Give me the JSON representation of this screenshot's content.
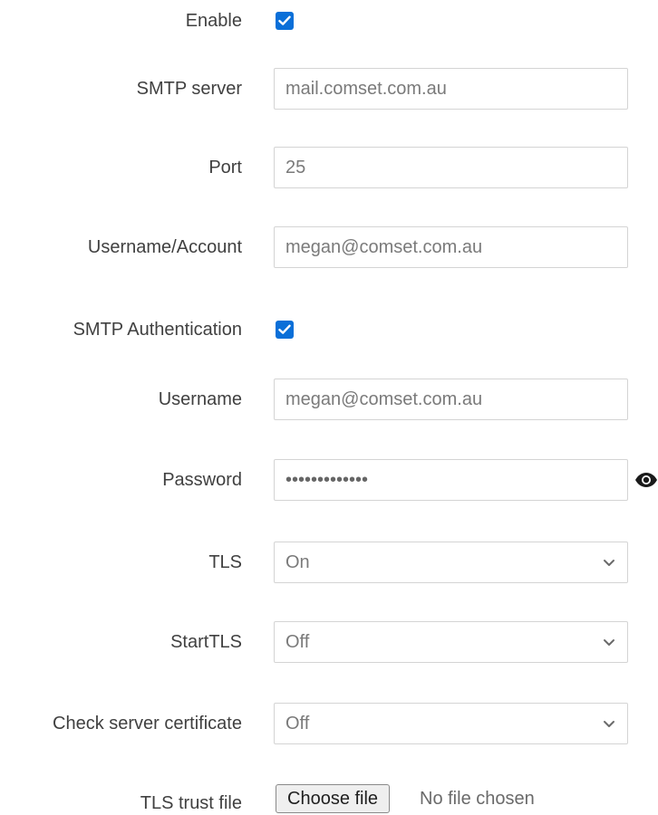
{
  "form": {
    "enable": {
      "label": "Enable",
      "checked": true
    },
    "smtp_server": {
      "label": "SMTP server",
      "value": "mail.comset.com.au"
    },
    "port": {
      "label": "Port",
      "value": "25"
    },
    "username_account": {
      "label": "Username/Account",
      "value": "megan@comset.com.au"
    },
    "smtp_auth": {
      "label": "SMTP Authentication",
      "checked": true
    },
    "username": {
      "label": "Username",
      "value": "megan@comset.com.au"
    },
    "password": {
      "label": "Password",
      "value": "•••••••••••••",
      "reveal_icon": "eye-icon"
    },
    "tls": {
      "label": "TLS",
      "selected": "On",
      "icon": "chevron-down-icon"
    },
    "starttls": {
      "label": "StartTLS",
      "selected": "Off",
      "icon": "chevron-down-icon"
    },
    "check_cert": {
      "label": "Check server certificate",
      "selected": "Off",
      "icon": "chevron-down-icon"
    },
    "tls_trust_file": {
      "label": "TLS trust file",
      "button_label": "Choose file",
      "status": "No file chosen"
    }
  },
  "colors": {
    "checkbox": "#0a6fd8",
    "label_text": "#404040",
    "field_text": "#7a7a7a",
    "field_border": "#d4d4d4"
  }
}
